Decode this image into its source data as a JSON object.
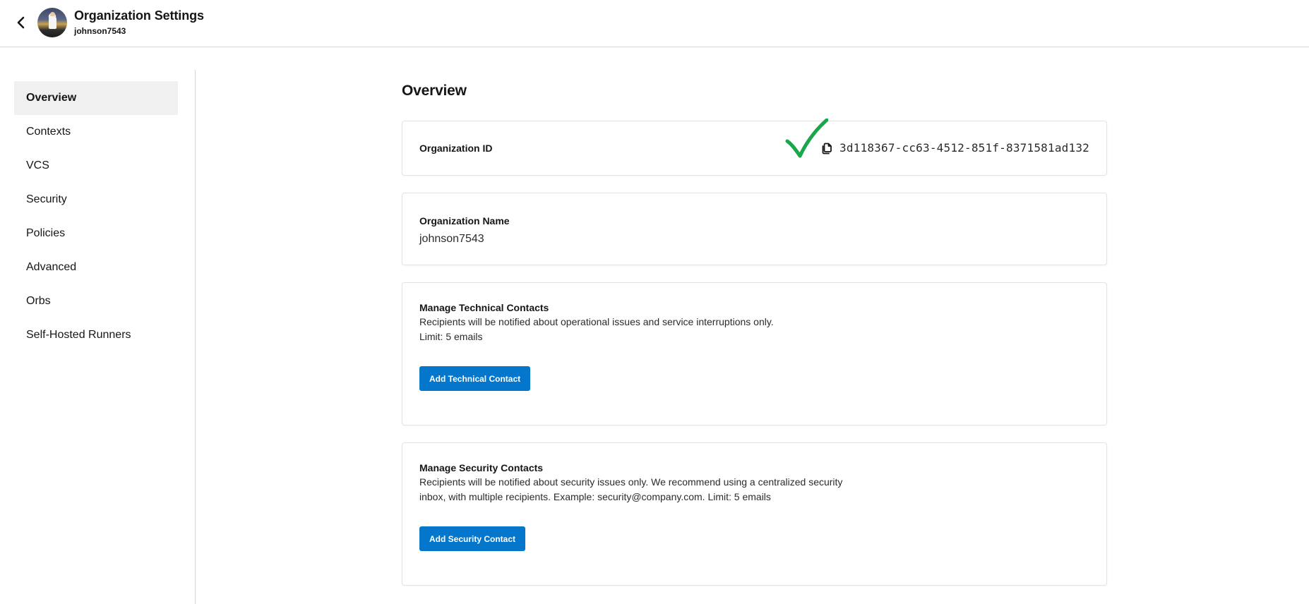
{
  "header": {
    "title": "Organization Settings",
    "subtitle": "johnson7543",
    "back_icon": "chevron-left-icon",
    "avatar_icon": "user-avatar"
  },
  "sidebar": {
    "items": [
      {
        "label": "Overview",
        "active": true
      },
      {
        "label": "Contexts",
        "active": false
      },
      {
        "label": "VCS",
        "active": false
      },
      {
        "label": "Security",
        "active": false
      },
      {
        "label": "Policies",
        "active": false
      },
      {
        "label": "Advanced",
        "active": false
      },
      {
        "label": "Orbs",
        "active": false
      },
      {
        "label": "Self-Hosted Runners",
        "active": false
      }
    ]
  },
  "main": {
    "title": "Overview",
    "org_id": {
      "label": "Organization ID",
      "value": "3d118367-cc63-4512-851f-8371581ad132",
      "copy_icon": "copy-icon",
      "copied_indicator": "checkmark-icon",
      "indicator_color": "#1aa64b"
    },
    "org_name": {
      "label": "Organization Name",
      "value": "johnson7543"
    },
    "technical_contacts": {
      "title": "Manage Technical Contacts",
      "description_line1": "Recipients will be notified about operational issues and service interruptions only.",
      "description_line2": "Limit: 5 emails",
      "button_label": "Add Technical Contact"
    },
    "security_contacts": {
      "title": "Manage Security Contacts",
      "description": "Recipients will be notified about security issues only. We recommend using a centralized security inbox, with multiple recipients. Example: security@company.com. Limit: 5 emails",
      "button_label": "Add Security Contact"
    }
  },
  "colors": {
    "primary_button": "#0477cd",
    "active_nav_bg": "#f0f0f0",
    "check_green": "#1aa64b"
  }
}
